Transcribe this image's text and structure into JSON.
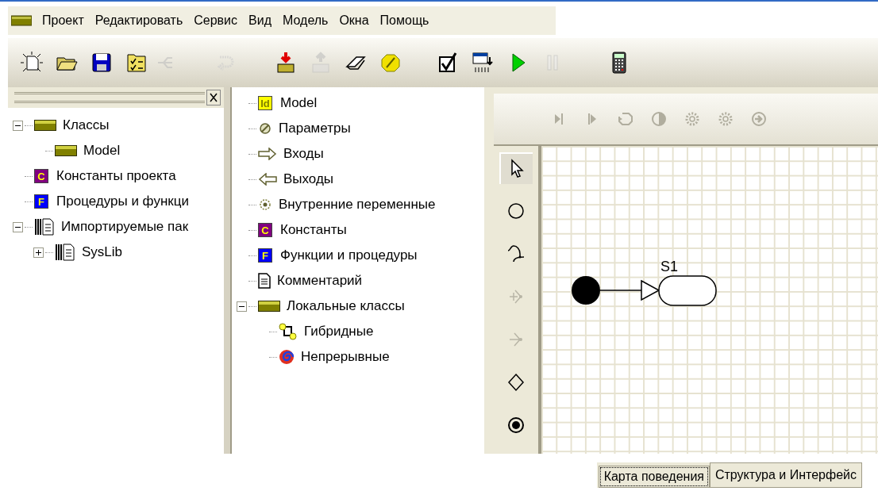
{
  "menu": {
    "items": [
      "Проект",
      "Редактировать",
      "Сервис",
      "Вид",
      "Модель",
      "Окна",
      "Помощь"
    ]
  },
  "toolbar": [
    {
      "kind": "new",
      "disabled": false
    },
    {
      "kind": "open",
      "disabled": false
    },
    {
      "kind": "save",
      "disabled": false
    },
    {
      "kind": "checklist",
      "disabled": false
    },
    {
      "kind": "tree",
      "disabled": true
    },
    {
      "kind": "redo",
      "disabled": true
    },
    {
      "kind": "import",
      "disabled": false
    },
    {
      "kind": "export",
      "disabled": true
    },
    {
      "kind": "eraser",
      "disabled": false
    },
    {
      "kind": "stop",
      "disabled": false
    },
    {
      "kind": "check",
      "disabled": false
    },
    {
      "kind": "compile",
      "disabled": false
    },
    {
      "kind": "run",
      "disabled": false
    },
    {
      "kind": "pause",
      "disabled": true
    },
    {
      "kind": "calculator",
      "disabled": false
    }
  ],
  "project_tree": [
    {
      "label": "Классы",
      "kind": "class",
      "expanded": true,
      "children": [
        {
          "label": "Model",
          "kind": "class"
        }
      ]
    },
    {
      "label": "Константы проекта",
      "kind": "badge",
      "badge": "C",
      "color": "#800080"
    },
    {
      "label": "Процедуры и функци",
      "kind": "badge",
      "badge": "F",
      "color": "#0000ff"
    },
    {
      "label": "Импортируемые пак",
      "kind": "package",
      "expanded": true,
      "children": [
        {
          "label": "SysLib",
          "kind": "package",
          "expanded": false
        }
      ]
    }
  ],
  "class_tree": [
    {
      "label": "Model",
      "kind": "badge",
      "badge": "Id",
      "color": "#ffff00"
    },
    {
      "label": "Параметры",
      "kind": "param"
    },
    {
      "label": "Входы",
      "kind": "input"
    },
    {
      "label": "Выходы",
      "kind": "output"
    },
    {
      "label": "Внутренние переменные",
      "kind": "internal"
    },
    {
      "label": "Константы",
      "kind": "badge",
      "badge": "C",
      "color": "#800080"
    },
    {
      "label": "Функции и процедуры",
      "kind": "badge",
      "badge": "F",
      "color": "#0000ff"
    },
    {
      "label": "Комментарий",
      "kind": "comment"
    },
    {
      "label": "Локальные классы",
      "kind": "class",
      "expanded": true,
      "children": [
        {
          "label": "Гибридные",
          "kind": "hybrid"
        },
        {
          "label": "Непрерывные",
          "kind": "continuous"
        }
      ]
    }
  ],
  "diagram_toolbar": [
    {
      "kind": "step-end",
      "disabled": true
    },
    {
      "kind": "step",
      "disabled": true
    },
    {
      "kind": "reset",
      "disabled": true
    },
    {
      "kind": "half",
      "disabled": true
    },
    {
      "kind": "gear",
      "disabled": true
    },
    {
      "kind": "gear",
      "disabled": true
    },
    {
      "kind": "forward",
      "disabled": true
    }
  ],
  "palette": [
    {
      "kind": "pointer",
      "selected": true,
      "disabled": false
    },
    {
      "kind": "state",
      "selected": false,
      "disabled": false
    },
    {
      "kind": "transition",
      "selected": false,
      "disabled": false
    },
    {
      "kind": "fork",
      "selected": false,
      "disabled": true
    },
    {
      "kind": "join",
      "selected": false,
      "disabled": true
    },
    {
      "kind": "choice",
      "selected": false,
      "disabled": false
    },
    {
      "kind": "final",
      "selected": false,
      "disabled": false
    }
  ],
  "diagram": {
    "states": [
      {
        "name": "S1"
      }
    ]
  },
  "tabs": [
    {
      "label": "Карта поведения",
      "selected": true
    },
    {
      "label": "Структура и Интерфейс",
      "selected": false
    }
  ]
}
